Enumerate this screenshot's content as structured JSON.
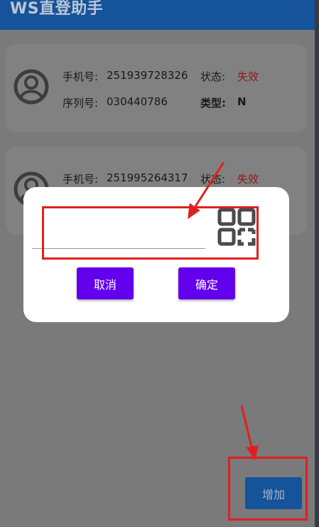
{
  "app": {
    "title": "WS直登助手"
  },
  "cards": [
    {
      "phone_label": "手机号:",
      "phone": "251939728326",
      "status_label": "状态:",
      "status": "失效",
      "serial_label": "序列号:",
      "serial": "030440786",
      "type_label": "类型:",
      "type": "N"
    },
    {
      "phone_label": "手机号:",
      "phone": "251995264317",
      "status_label": "状态:",
      "status": "失效"
    }
  ],
  "dialog": {
    "input_value": "",
    "cancel_label": "取消",
    "ok_label": "确定"
  },
  "fab": {
    "add_label": "增加"
  },
  "colors": {
    "appbar": "#15539b",
    "accent": "#6200ee",
    "status_invalid": "#8b1a1a",
    "annotation": "#e02020"
  }
}
